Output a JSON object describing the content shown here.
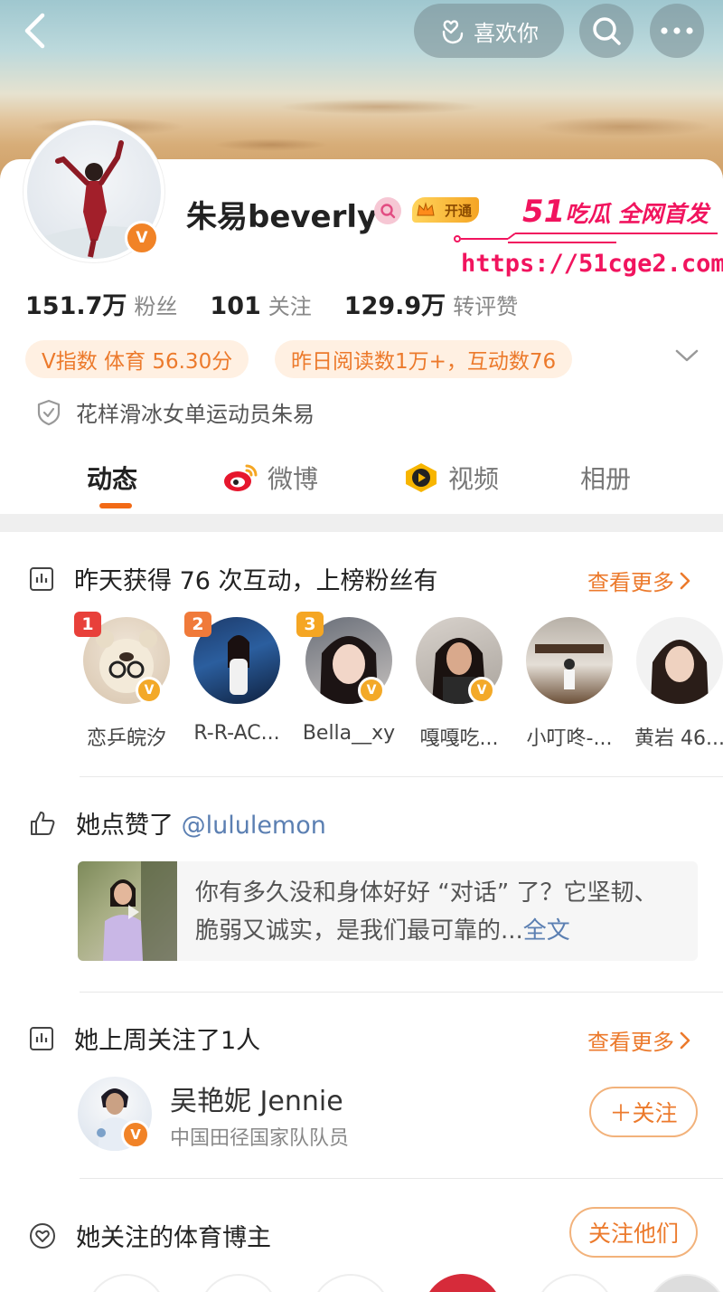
{
  "header": {
    "back_icon": "chevron-left-icon",
    "like_label": "喜欢你",
    "like_icon": "hand-heart-icon",
    "search_icon": "search-icon",
    "more_icon": "more-icon"
  },
  "profile": {
    "name": "朱易beverly",
    "vip_label": "开通",
    "verified_mark": "V",
    "watermark": {
      "line1_number": "51",
      "line1_text": "吃瓜 全网首发",
      "url": "https://51cge2.com"
    },
    "stats": [
      {
        "value": "151.7万",
        "label": "粉丝"
      },
      {
        "value": "101",
        "label": "关注"
      },
      {
        "value": "129.9万",
        "label": "转评赞"
      }
    ],
    "tags": [
      "V指数 体育 56.30分",
      "昨日阅读数1万+，互动数76"
    ],
    "description": "花样滑冰女单运动员朱易"
  },
  "tabs": [
    {
      "label": "动态",
      "icon": "",
      "active": true
    },
    {
      "label": "微博",
      "icon": "weibo-icon",
      "active": false
    },
    {
      "label": "视频",
      "icon": "video-icon",
      "active": false
    },
    {
      "label": "相册",
      "icon": "",
      "active": false
    }
  ],
  "fans_section": {
    "title": "昨天获得 76 次互动，上榜粉丝有",
    "see_more": "查看更多",
    "fans": [
      {
        "name": "恋乒皖汐",
        "rank": "1",
        "verified": true
      },
      {
        "name": "R-R-AC...",
        "rank": "2",
        "verified": false
      },
      {
        "name": "Bella__xy",
        "rank": "3",
        "verified": true
      },
      {
        "name": "嘎嘎吃...",
        "rank": "",
        "verified": true
      },
      {
        "name": "小叮咚-...",
        "rank": "",
        "verified": false
      },
      {
        "name": "黄岩 46...",
        "rank": "",
        "verified": false
      }
    ]
  },
  "like_section": {
    "prefix": "她点赞了",
    "mention": "@lululemon",
    "post_text": "你有多久没和身体好好 “对话” 了？它坚韧、脆弱又诚实，是我们最可靠的...",
    "post_more": "全文"
  },
  "follow_section": {
    "title": "她上周关注了1人",
    "see_more": "查看更多",
    "user_name": "吴艳妮 Jennie",
    "user_desc": "中国田径国家队队员",
    "follow_button": "＋关注"
  },
  "sports_section": {
    "title": "她关注的体育博主",
    "follow_all_button": "关注他们"
  },
  "colors": {
    "accent": "#ec7a2c",
    "tab_underline": "#f26a16",
    "link_blue": "#5b7fb2",
    "watermark_pink": "#f1145e"
  }
}
